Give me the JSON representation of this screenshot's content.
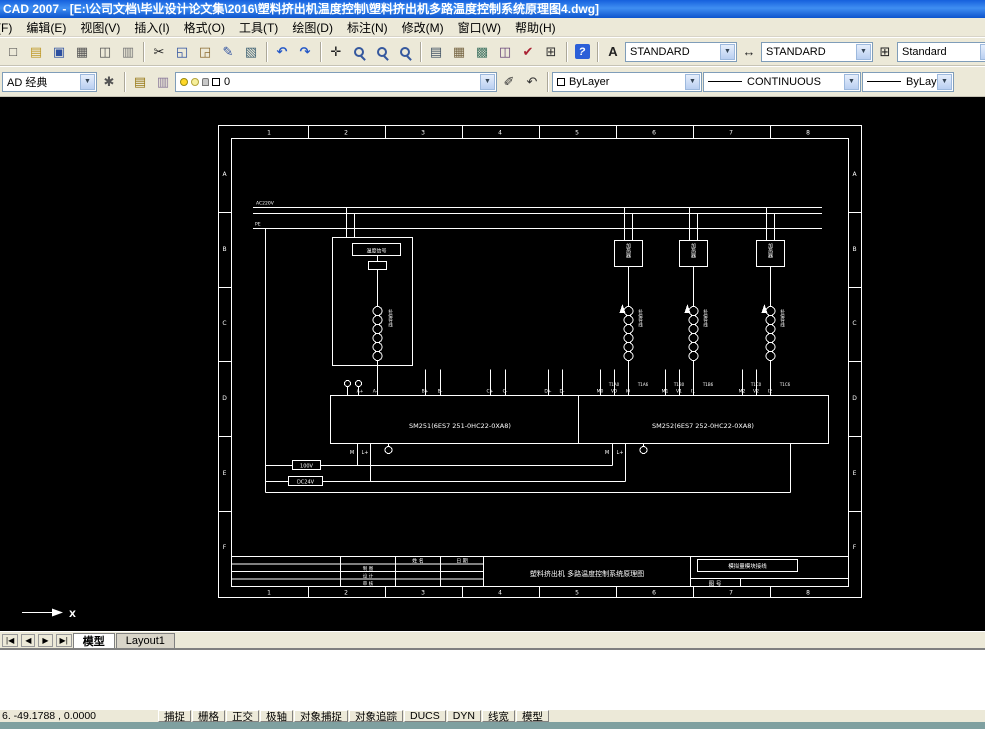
{
  "window": {
    "title": "CAD 2007 - [E:\\公司文档\\毕业设计论文集\\2016\\塑料挤出机温度控制\\塑料挤出机多路温度控制系统原理图4.dwg]"
  },
  "menus": [
    "文件(F)",
    "编辑(E)",
    "视图(V)",
    "插入(I)",
    "格式(O)",
    "工具(T)",
    "绘图(D)",
    "标注(N)",
    "修改(M)",
    "窗口(W)",
    "帮助(H)"
  ],
  "toolbar1": {
    "icons": [
      "new",
      "open",
      "save",
      "plot",
      "plot-preview",
      "publish",
      "cut",
      "copy",
      "paste",
      "match-properties",
      "block-editor",
      "undo",
      "redo",
      "pan",
      "zoom-realtime",
      "zoom-window",
      "zoom-previous",
      "properties",
      "designcenter",
      "tool-palettes",
      "sheetset-manager",
      "markup",
      "quickcalc",
      "help"
    ],
    "text_style": "STANDARD",
    "dim_style": "STANDARD",
    "table_style": "Standard"
  },
  "toolbar2": {
    "workspace": "AD 经典",
    "layer_name": "0",
    "color": "ByLayer",
    "linetype": "CONTINUOUS",
    "lineweight": "ByLayer"
  },
  "tabs": {
    "nav": [
      "|◀",
      "◀",
      "▶",
      "▶|"
    ],
    "model": "模型",
    "layout1": "Layout1"
  },
  "statusbar": {
    "coords": "6.  -49.1788 ,  0.0000",
    "toggles": [
      "捕捉",
      "栅格",
      "正交",
      "极轴",
      "对象捕捉",
      "对象追踪",
      "DUCS",
      "DYN",
      "线宽",
      "模型"
    ]
  },
  "drawing": {
    "ruler_top": [
      "1",
      "2",
      "3",
      "4",
      "5",
      "6",
      "7",
      "8"
    ],
    "ruler_left": [
      "A",
      "B",
      "C",
      "D",
      "E",
      "F"
    ],
    "bus1_label": "AC220V",
    "bus_pe_label": "PE",
    "signal_box_label": "温度信号",
    "heater_label": "加热器",
    "tc_label": "补偿导线",
    "left_terms": [
      "A+",
      "A-",
      "B+",
      "B-",
      "C+",
      "C-",
      "D+",
      "D-"
    ],
    "right_terms": [
      "M0",
      "V0",
      "I0",
      "M1",
      "V1",
      "I1",
      "M2",
      "V2",
      "I2"
    ],
    "coil_terms": [
      "T1A0",
      "T1A6",
      "T1B0",
      "T1B6",
      "T1C0",
      "T1C6"
    ],
    "module_left": "SM251(6ES7 251-0HC22-0XA8)",
    "module_right": "SM252(6ES7 252-0HC22-0XA8)",
    "m_label": "M",
    "lplus_label": "L+",
    "v100_label": "100V",
    "dc24_label": "DC24V",
    "ucs_x": "X",
    "titleblock": {
      "name_col": "姓 名",
      "date_col": "日 期",
      "rows": [
        "制 图",
        "设 计",
        "审 核"
      ],
      "title": "塑料挤出机 多路温度控制系统原理图",
      "right_top": "模拟量模块接线",
      "right_bottom": "图 号"
    }
  }
}
